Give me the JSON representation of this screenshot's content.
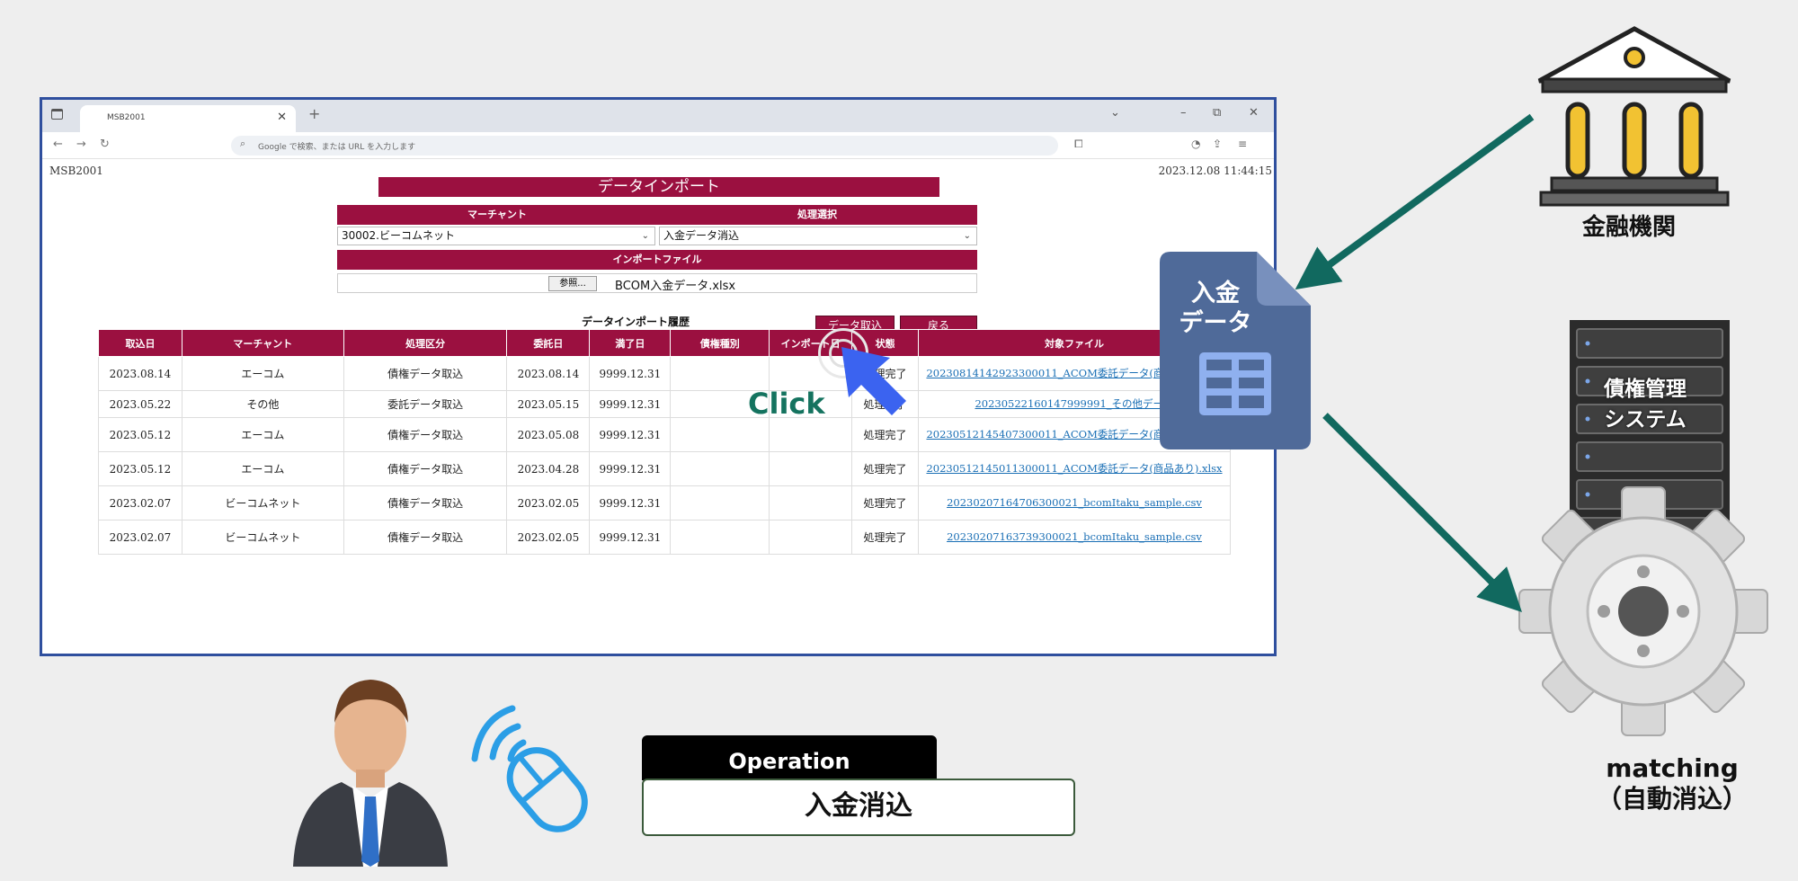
{
  "browser": {
    "tab_title": "MSB2001",
    "url_placeholder": "Google で検索、または URL を入力します"
  },
  "page": {
    "screen_id": "MSB2001",
    "datetime": "2023.12.08 11:44:15",
    "title": "データインポート",
    "form": {
      "merchant_header": "マーチャント",
      "process_header": "処理選択",
      "merchant_value": "30002.ビーコムネット",
      "process_value": "入金データ消込",
      "import_file_header": "インポートファイル",
      "browse_label": "参照...",
      "file_name": "BCOM入金データ.xlsx",
      "import_button": "データ取込",
      "back_button": "戻る"
    },
    "history": {
      "title": "データインポート履歴",
      "columns": [
        "取込日",
        "マーチャント",
        "処理区分",
        "委託日",
        "満了日",
        "債権種別",
        "インポート日",
        "状態",
        "対象ファイル"
      ],
      "rows": [
        {
          "date": "2023.08.14",
          "merchant": "エーコム",
          "kind": "債権データ取込",
          "entrust": "2023.08.14",
          "expiry": "9999.12.31",
          "claim": "",
          "import": "",
          "status": "処理完了",
          "file": "20230814142923300011_ACOM委託データ(商品あり).xlsx"
        },
        {
          "date": "2023.05.22",
          "merchant": "その他",
          "kind": "委託データ取込",
          "entrust": "2023.05.15",
          "expiry": "9999.12.31",
          "claim": "",
          "import": "",
          "status": "処理完了",
          "file": "20230522160147999991_その他データ"
        },
        {
          "date": "2023.05.12",
          "merchant": "エーコム",
          "kind": "債権データ取込",
          "entrust": "2023.05.08",
          "expiry": "9999.12.31",
          "claim": "",
          "import": "",
          "status": "処理完了",
          "file": "20230512145407300011_ACOM委託データ(商品あり).xlsx"
        },
        {
          "date": "2023.05.12",
          "merchant": "エーコム",
          "kind": "債権データ取込",
          "entrust": "2023.04.28",
          "expiry": "9999.12.31",
          "claim": "",
          "import": "",
          "status": "処理完了",
          "file": "20230512145011300011_ACOM委託データ(商品あり).xlsx"
        },
        {
          "date": "2023.02.07",
          "merchant": "ビーコムネット",
          "kind": "債権データ取込",
          "entrust": "2023.02.05",
          "expiry": "9999.12.31",
          "claim": "",
          "import": "",
          "status": "処理完了",
          "file": "20230207164706300021_bcomItaku_sample.csv"
        },
        {
          "date": "2023.02.07",
          "merchant": "ビーコムネット",
          "kind": "債権データ取込",
          "entrust": "2023.02.05",
          "expiry": "9999.12.31",
          "claim": "",
          "import": "",
          "status": "処理完了",
          "file": "20230207163739300021_bcomItaku_sample.csv"
        }
      ]
    }
  },
  "overlay": {
    "click_label": "Click",
    "pointer_icon": "arrow-cursor-icon"
  },
  "diagram": {
    "bank_label": "金融機関",
    "document_label_line1": "入金",
    "document_label_line2": "データ",
    "server_label_line1": "債権管理",
    "server_label_line2": "システム",
    "gear_label_line1": "matching",
    "gear_label_line2": "（自動消込）",
    "operation_header": "Operation",
    "operation_value": "入金消込",
    "colors": {
      "accent": "#9b1040",
      "arrow": "#11695f",
      "doc": "#4f6a99",
      "window_border": "#2f4f9e"
    }
  }
}
